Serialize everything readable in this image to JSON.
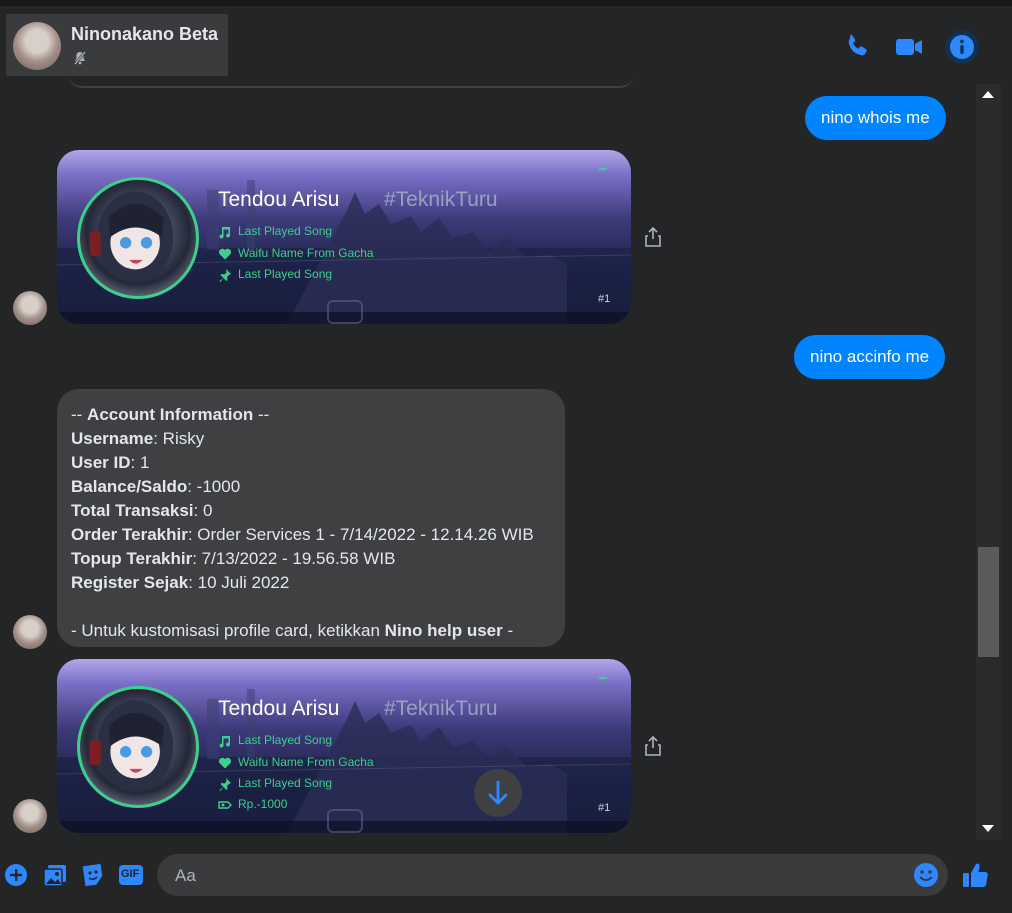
{
  "header": {
    "contact_name": "Ninonakano Beta",
    "muted_icon": "bell-slash-icon",
    "icons": [
      "phone-icon",
      "video-camera-icon",
      "info-icon"
    ]
  },
  "colors": {
    "accent": "#0084ff",
    "background": "#242526",
    "incoming_bubble": "#3e4042",
    "card_green": "#3ccf8e"
  },
  "messages": {
    "out1": "nino whois me",
    "out2": "nino accinfo me"
  },
  "card1": {
    "name": "Tendou Arisu",
    "tag": "#TeknikTuru",
    "row1": "Last Played Song",
    "row2": "Waifu Name From Gacha",
    "row3": "Last Played Song",
    "number": "#1"
  },
  "account_info": {
    "header_prefix": "-- ",
    "header": "Account Information",
    "header_suffix": " --",
    "rows": [
      {
        "label": "Username",
        "value": ": Risky"
      },
      {
        "label": "User ID",
        "value": ": 1"
      },
      {
        "label": "Balance/Saldo",
        "value": ": -1000"
      },
      {
        "label": "Total Transaksi",
        "value": ": 0"
      },
      {
        "label": "Order Terakhir",
        "value": ": Order Services 1 - 7/14/2022 - 12.14.26 WIB"
      },
      {
        "label": "Topup Terakhir",
        "value": ": 7/13/2022 - 19.56.58 WIB"
      },
      {
        "label": "Register Sejak",
        "value": ": 10 Juli 2022"
      }
    ],
    "footer_prefix": "- Untuk kustomisasi profile card, ketikkan ",
    "footer_command": "Nino help user",
    "footer_suffix": " -"
  },
  "card2": {
    "name": "Tendou Arisu",
    "tag": "#TeknikTuru",
    "row1": "Last Played Song",
    "row2": "Waifu Name From Gacha",
    "row3": "Last Played Song",
    "row4": "Rp.-1000",
    "number": "#1"
  },
  "composer": {
    "placeholder": "Aa",
    "tools": [
      "plus-icon",
      "image-icon",
      "sticker-icon",
      "gif-icon"
    ],
    "gif_label": "GIF"
  }
}
